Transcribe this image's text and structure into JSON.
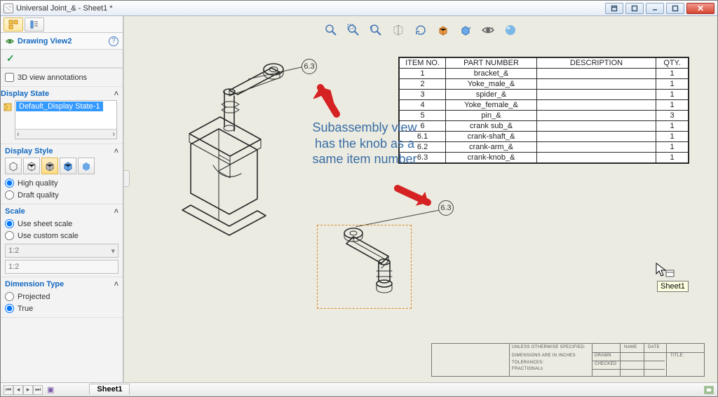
{
  "window": {
    "title": "Universal Joint_& - Sheet1 *"
  },
  "panel": {
    "title": "Drawing View2",
    "confirm_glyph": "✓",
    "cb_3d_view": "3D view annotations",
    "display_state": {
      "title": "Display State",
      "item": "Default_Display State-1"
    },
    "display_style": {
      "title": "Display Style",
      "high": "High quality",
      "draft": "Draft quality"
    },
    "scale": {
      "title": "Scale",
      "sheet": "Use sheet scale",
      "custom": "Use custom scale",
      "value1": "1:2",
      "value2": "1:2"
    },
    "dimension": {
      "title": "Dimension Type",
      "projected": "Projected",
      "true": "True"
    }
  },
  "status": {
    "sheet_tab": "Sheet1",
    "sheet_icon": "▣"
  },
  "bom": {
    "headers": {
      "item": "ITEM NO.",
      "part": "PART NUMBER",
      "desc": "DESCRIPTION",
      "qty": "QTY."
    },
    "rows": [
      {
        "item": "1",
        "part": "bracket_&",
        "desc": "",
        "qty": "1"
      },
      {
        "item": "2",
        "part": "Yoke_male_&",
        "desc": "",
        "qty": "1"
      },
      {
        "item": "3",
        "part": "spider_&",
        "desc": "",
        "qty": "1"
      },
      {
        "item": "4",
        "part": "Yoke_female_&",
        "desc": "",
        "qty": "1"
      },
      {
        "item": "5",
        "part": "pin_&",
        "desc": "",
        "qty": "3"
      },
      {
        "item": "6",
        "part": "crank sub_&",
        "desc": "",
        "qty": "1"
      },
      {
        "item": "6.1",
        "part": "crank-shaft_&",
        "desc": "",
        "qty": "1"
      },
      {
        "item": "6.2",
        "part": "crank-arm_&",
        "desc": "",
        "qty": "1"
      },
      {
        "item": "6.3",
        "part": "crank-knob_&",
        "desc": "",
        "qty": "1"
      }
    ]
  },
  "annotation": "Subassembly view has the knob as a same item number",
  "balloon1": "6.3",
  "balloon2": "6.3",
  "tooltip": "Sheet1",
  "titleblock": {
    "t1": "UNLESS OTHERWISE SPECIFIED:",
    "t2": "DIMENSIONS ARE IN INCHES",
    "t3": "TOLERANCES:",
    "t4": "FRACTIONAL±",
    "t5": "DRAWN",
    "t6": "CHECKED",
    "t7": "NAME",
    "t8": "DATE",
    "t9": "TITLE:"
  }
}
